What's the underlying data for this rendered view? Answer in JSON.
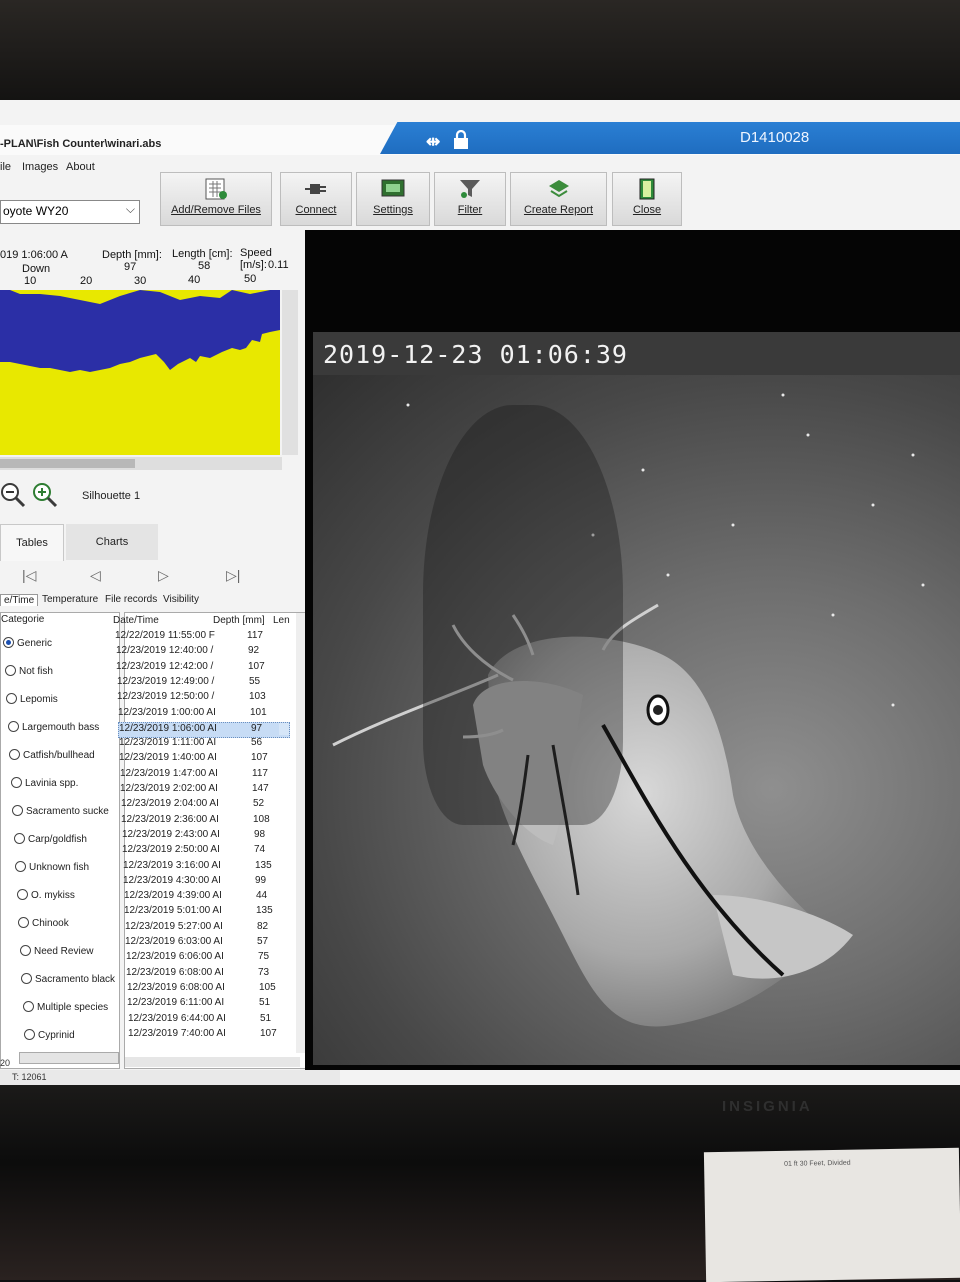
{
  "window": {
    "title": "-PLAN\\Fish Counter\\winari.abs",
    "device_id": "D1410028"
  },
  "menu": [
    "ile",
    "Images",
    "About"
  ],
  "toolbar": {
    "site_value": "oyote WY20",
    "buttons": [
      {
        "label": "Add/Remove Files",
        "icon": "file-grid-icon"
      },
      {
        "label": "Connect",
        "icon": "plug-icon"
      },
      {
        "label": "Settings",
        "icon": "monitor-icon"
      },
      {
        "label": "Filter",
        "icon": "funnel-icon"
      },
      {
        "label": "Create Report",
        "icon": "report-icon"
      },
      {
        "label": "Close",
        "icon": "door-icon"
      }
    ]
  },
  "echogram": {
    "time": "019 1:06:00 A",
    "direction": "Down",
    "depth_label": "Depth [mm]:",
    "depth_value": "97",
    "length_label": "Length [cm]:",
    "length_value": "58",
    "speed_label": "Speed [m/s]:",
    "speed_value": "0.11",
    "scale": [
      "10",
      "20",
      "30",
      "40",
      "50"
    ],
    "colors": {
      "background": "#e8e800",
      "fish": "#2b2fa6"
    }
  },
  "zoom": {
    "silhouette_label": "Silhouette 1"
  },
  "tabs": [
    {
      "label": "Tables",
      "active": true
    },
    {
      "label": "Charts",
      "active": false
    }
  ],
  "subtabs": [
    "e/Time",
    "Temperature",
    "File records",
    "Visibility"
  ],
  "categories": {
    "header": "Categorie",
    "items": [
      {
        "label": "Generic",
        "selected": true
      },
      {
        "label": "Not fish",
        "selected": false
      },
      {
        "label": "Lepomis",
        "selected": false
      },
      {
        "label": "Largemouth bass",
        "selected": false
      },
      {
        "label": "Catfish/bullhead",
        "selected": false
      },
      {
        "label": "Lavinia spp.",
        "selected": false
      },
      {
        "label": "Sacramento sucke",
        "selected": false
      },
      {
        "label": "Carp/goldfish",
        "selected": false
      },
      {
        "label": "Unknown fish",
        "selected": false
      },
      {
        "label": "O. mykiss",
        "selected": false
      },
      {
        "label": "Chinook",
        "selected": false
      },
      {
        "label": "Need Review",
        "selected": false
      },
      {
        "label": "Sacramento black",
        "selected": false
      },
      {
        "label": "Multiple species",
        "selected": false
      },
      {
        "label": "Cyprinid",
        "selected": false
      }
    ]
  },
  "records": {
    "headers": {
      "datetime": "Date/Time",
      "depth": "Depth [mm]",
      "length": "Len"
    },
    "rows": [
      {
        "datetime": "12/22/2019 11:55:00 F",
        "depth": "117"
      },
      {
        "datetime": "12/23/2019 12:40:00 /",
        "depth": "92"
      },
      {
        "datetime": "12/23/2019 12:42:00 /",
        "depth": "107"
      },
      {
        "datetime": "12/23/2019 12:49:00 /",
        "depth": "55"
      },
      {
        "datetime": "12/23/2019 12:50:00 /",
        "depth": "103"
      },
      {
        "datetime": "12/23/2019 1:00:00 AI",
        "depth": "101"
      },
      {
        "datetime": "12/23/2019 1:06:00 AI",
        "depth": "97",
        "selected": true
      },
      {
        "datetime": "12/23/2019 1:11:00 AI",
        "depth": "56"
      },
      {
        "datetime": "12/23/2019 1:40:00 AI",
        "depth": "107"
      },
      {
        "datetime": "12/23/2019 1:47:00 AI",
        "depth": "117"
      },
      {
        "datetime": "12/23/2019 2:02:00 AI",
        "depth": "147"
      },
      {
        "datetime": "12/23/2019 2:04:00 AI",
        "depth": "52"
      },
      {
        "datetime": "12/23/2019 2:36:00 AI",
        "depth": "108"
      },
      {
        "datetime": "12/23/2019 2:43:00 AI",
        "depth": "98"
      },
      {
        "datetime": "12/23/2019 2:50:00 AI",
        "depth": "74"
      },
      {
        "datetime": "12/23/2019 3:16:00 AI",
        "depth": "135"
      },
      {
        "datetime": "12/23/2019 4:30:00 AI",
        "depth": "99"
      },
      {
        "datetime": "12/23/2019 4:39:00 AI",
        "depth": "44"
      },
      {
        "datetime": "12/23/2019 5:01:00 AI",
        "depth": "135"
      },
      {
        "datetime": "12/23/2019 5:27:00 AI",
        "depth": "82"
      },
      {
        "datetime": "12/23/2019 6:03:00 AI",
        "depth": "57"
      },
      {
        "datetime": "12/23/2019 6:06:00 AI",
        "depth": "75"
      },
      {
        "datetime": "12/23/2019 6:08:00 AI",
        "depth": "73"
      },
      {
        "datetime": "12/23/2019 6:08:00 AI",
        "depth": "105"
      },
      {
        "datetime": "12/23/2019 6:11:00 AI",
        "depth": "51"
      },
      {
        "datetime": "12/23/2019 6:44:00 AI",
        "depth": "51"
      },
      {
        "datetime": "12/23/2019 7:40:00 AI",
        "depth": "107"
      }
    ]
  },
  "status": {
    "text": "T: 12061",
    "left_num": "20"
  },
  "video": {
    "timestamp": "2019-12-23 01:06:39"
  },
  "monitor": {
    "brand": "INSIGNIA",
    "paper_text": "01 ft 30 Feet, Divided"
  }
}
